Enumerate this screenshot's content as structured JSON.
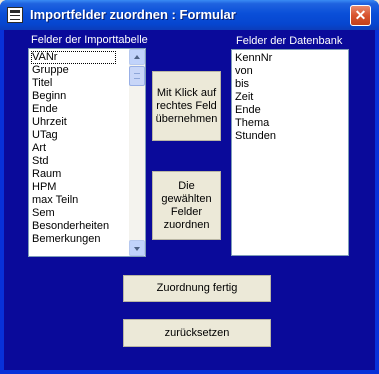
{
  "window": {
    "title": "Importfelder zuordnen : Formular",
    "close_glyph": "✕"
  },
  "left_panel": {
    "label": "Felder der Importtabelle",
    "items": [
      "VANr",
      "Gruppe",
      "Titel",
      "Beginn",
      "Ende",
      "Uhrzeit",
      "UTag",
      "Art",
      "Std",
      "Raum",
      "HPM",
      "max Teiln",
      "Sem",
      "Besonderheiten",
      "Bemerkungen"
    ],
    "selected_index": 0,
    "scroll_position": 0.0
  },
  "right_panel": {
    "label": "Felder der Datenbank",
    "items": [
      "KennNr",
      "von",
      "bis",
      "Zeit",
      "Ende",
      "Thema",
      "Stunden"
    ]
  },
  "buttons": {
    "take_field": "Mit Klick auf rechtes Feld übernehmen",
    "assign_fields": "Die gewählten Felder zuordnen",
    "done": "Zuordnung fertig",
    "reset": "zurücksetzen"
  },
  "icons": {
    "title_icon": "form-icon",
    "close": "close-icon",
    "scroll_up": "arrow-up-icon",
    "scroll_down": "arrow-down-icon"
  },
  "colors": {
    "form_background": "#0a0a9a",
    "titlebar": "#0646d0",
    "button_face": "#ece9d8"
  }
}
